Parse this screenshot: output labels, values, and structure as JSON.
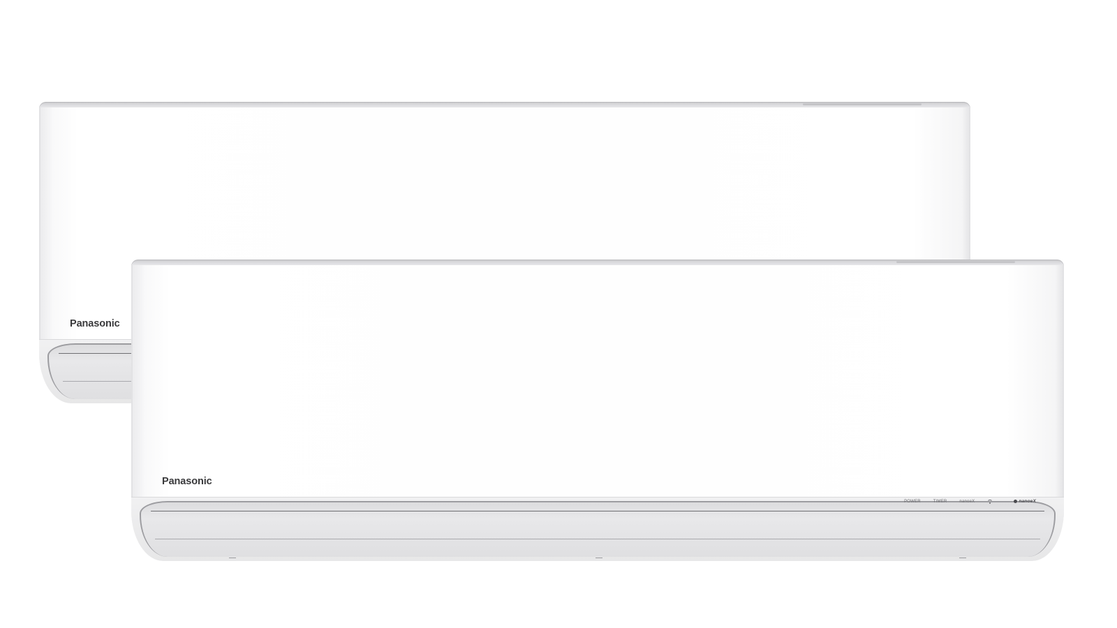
{
  "units": [
    {
      "brand": "Panasonic"
    },
    {
      "brand": "Panasonic",
      "indicators": {
        "power": "POWER",
        "timer": "TIMER",
        "nanoe": "nanoeX",
        "wifi_icon": "wifi-icon",
        "nanoe_logo": "nanoeX"
      }
    }
  ],
  "colors": {
    "background": "#ffffff",
    "body": "#ffffff",
    "brand_text": "#3a3a3c",
    "louver_frame": "#9c9ca0"
  }
}
